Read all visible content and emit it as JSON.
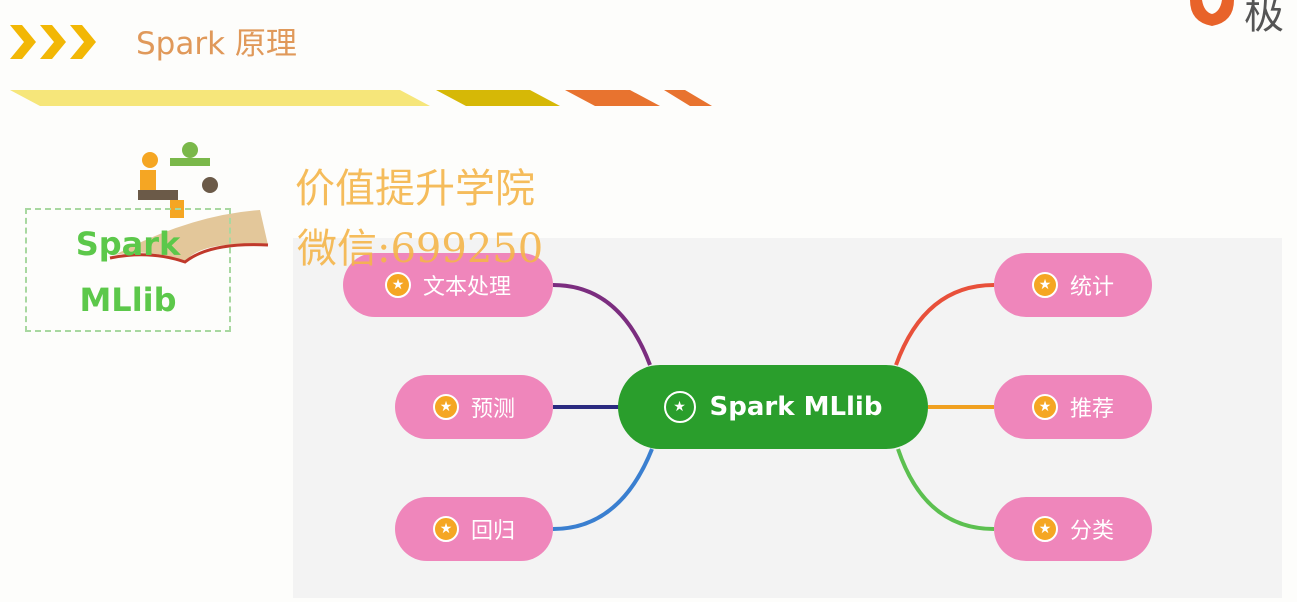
{
  "header": {
    "title": "Spark 原理",
    "logo_text": "极"
  },
  "watermark": {
    "line1": "价值提升学院",
    "line2": "微信:699250"
  },
  "side_box": {
    "line1": "Spark",
    "line2": "MLlib"
  },
  "mindmap": {
    "center": "Spark MLlib",
    "left": [
      {
        "label": "文本处理",
        "color": "#7b2d7f"
      },
      {
        "label": "预测",
        "color": "#2a2a80"
      },
      {
        "label": "回归",
        "color": "#3a7fd0"
      }
    ],
    "right": [
      {
        "label": "统计",
        "color": "#e8503a"
      },
      {
        "label": "推荐",
        "color": "#f0a020"
      },
      {
        "label": "分类",
        "color": "#5cc050"
      }
    ]
  },
  "colors": {
    "center": "#2a9e2c",
    "node": "#ef86bb",
    "star": "#f5a623",
    "accent": "#f2b705"
  }
}
